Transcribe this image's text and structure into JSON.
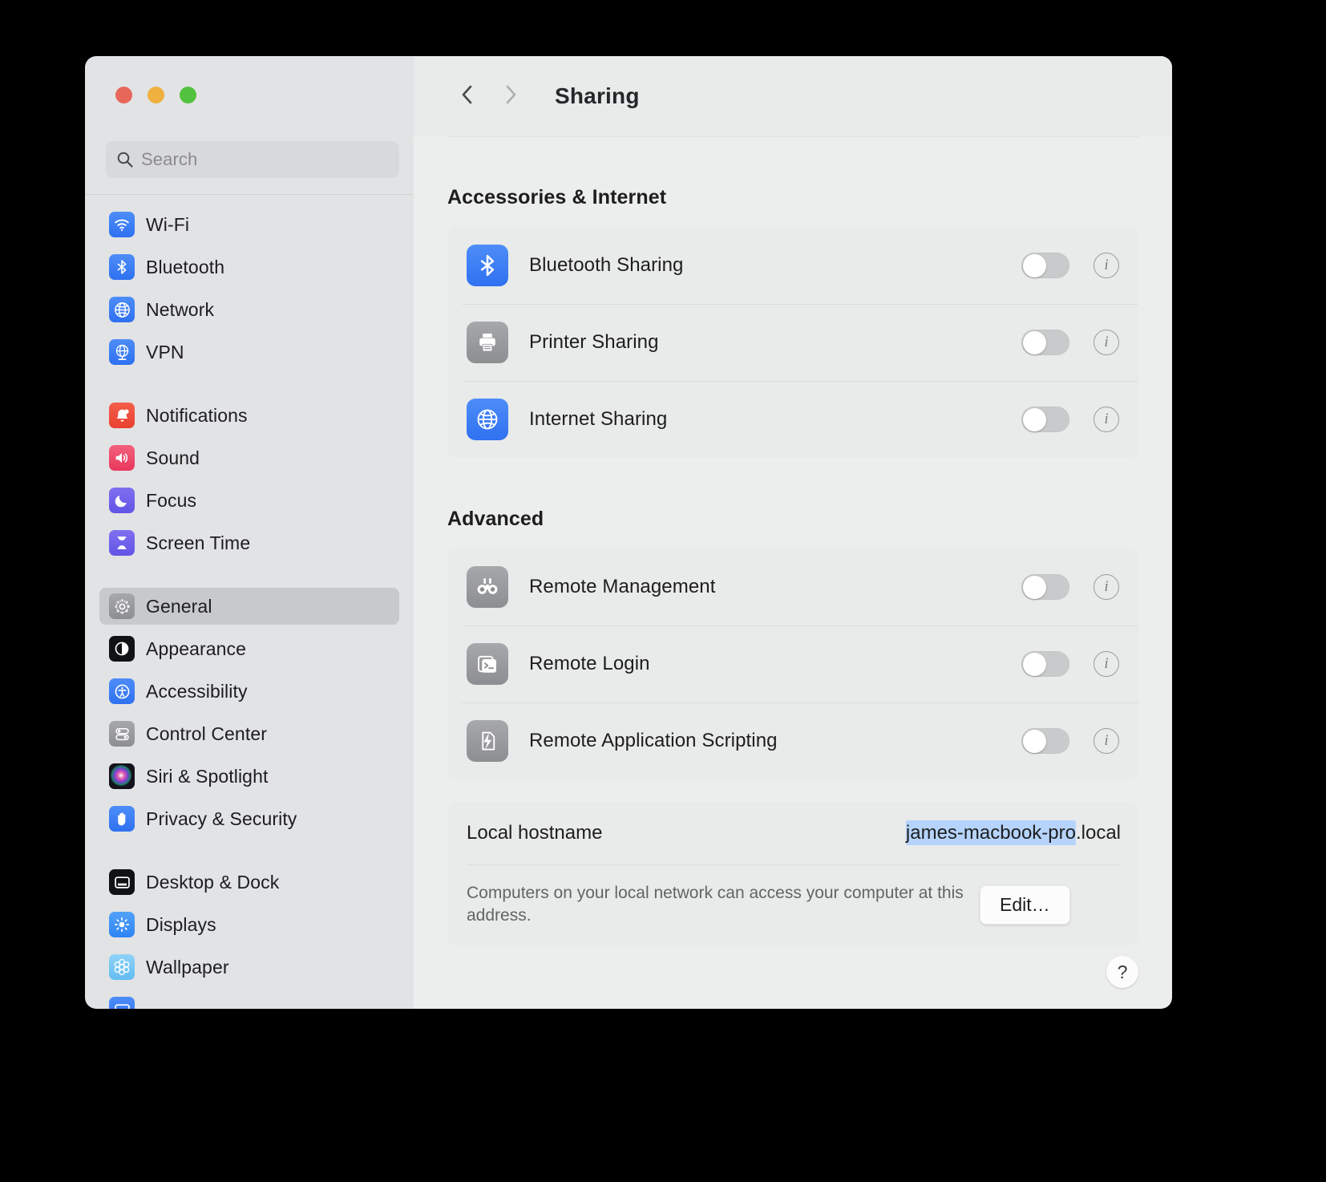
{
  "window": {
    "traffic_lights": [
      "close",
      "minimize",
      "zoom"
    ],
    "title": "Sharing"
  },
  "search": {
    "placeholder": "Search",
    "value": "",
    "icon": "search-icon"
  },
  "sidebar": {
    "groups": [
      {
        "items": [
          {
            "label": "Wi-Fi",
            "icon": "wifi-icon",
            "selected": false
          },
          {
            "label": "Bluetooth",
            "icon": "bluetooth-icon",
            "selected": false
          },
          {
            "label": "Network",
            "icon": "globe-icon",
            "selected": false
          },
          {
            "label": "VPN",
            "icon": "vpn-globe-icon",
            "selected": false
          }
        ]
      },
      {
        "items": [
          {
            "label": "Notifications",
            "icon": "bell-icon",
            "selected": false
          },
          {
            "label": "Sound",
            "icon": "speaker-icon",
            "selected": false
          },
          {
            "label": "Focus",
            "icon": "moon-icon",
            "selected": false
          },
          {
            "label": "Screen Time",
            "icon": "hourglass-icon",
            "selected": false
          }
        ]
      },
      {
        "items": [
          {
            "label": "General",
            "icon": "gear-icon",
            "selected": true
          },
          {
            "label": "Appearance",
            "icon": "appearance-icon",
            "selected": false
          },
          {
            "label": "Accessibility",
            "icon": "accessibility-icon",
            "selected": false
          },
          {
            "label": "Control Center",
            "icon": "control-center-icon",
            "selected": false
          },
          {
            "label": "Siri & Spotlight",
            "icon": "siri-icon",
            "selected": false
          },
          {
            "label": "Privacy & Security",
            "icon": "hand-icon",
            "selected": false
          }
        ]
      },
      {
        "items": [
          {
            "label": "Desktop & Dock",
            "icon": "desktop-dock-icon",
            "selected": false
          },
          {
            "label": "Displays",
            "icon": "brightness-icon",
            "selected": false
          },
          {
            "label": "Wallpaper",
            "icon": "wallpaper-icon",
            "selected": false
          }
        ]
      }
    ]
  },
  "toolbar": {
    "back_icon": "chevron-left-icon",
    "forward_icon": "chevron-right-icon",
    "title": "Sharing"
  },
  "main": {
    "sections": [
      {
        "title": "Accessories & Internet",
        "rows": [
          {
            "label": "Bluetooth Sharing",
            "icon": "bluetooth-icon",
            "toggle": "off",
            "info": "i"
          },
          {
            "label": "Printer Sharing",
            "icon": "printer-icon",
            "toggle": "off",
            "info": "i"
          },
          {
            "label": "Internet Sharing",
            "icon": "globe-icon",
            "toggle": "off",
            "info": "i"
          }
        ]
      },
      {
        "title": "Advanced",
        "rows": [
          {
            "label": "Remote Management",
            "icon": "binoculars-icon",
            "toggle": "off",
            "info": "i"
          },
          {
            "label": "Remote Login",
            "icon": "terminal-icon",
            "toggle": "off",
            "info": "i"
          },
          {
            "label": "Remote Application Scripting",
            "icon": "script-bolt-icon",
            "toggle": "off",
            "info": "i"
          }
        ]
      }
    ],
    "hostname": {
      "label": "Local hostname",
      "value_selected": "james-macbook-pro",
      "value_suffix": ".local",
      "description": "Computers on your local network can access your computer at this address.",
      "edit_label": "Edit…"
    },
    "help_label": "?"
  },
  "colors": {
    "accent_blue": "#3478f6",
    "selection_blue": "#b6d4fb",
    "sidebar_bg": "#e2e3e4",
    "detail_bg": "#eceded",
    "card_bg": "#e9eaea"
  }
}
